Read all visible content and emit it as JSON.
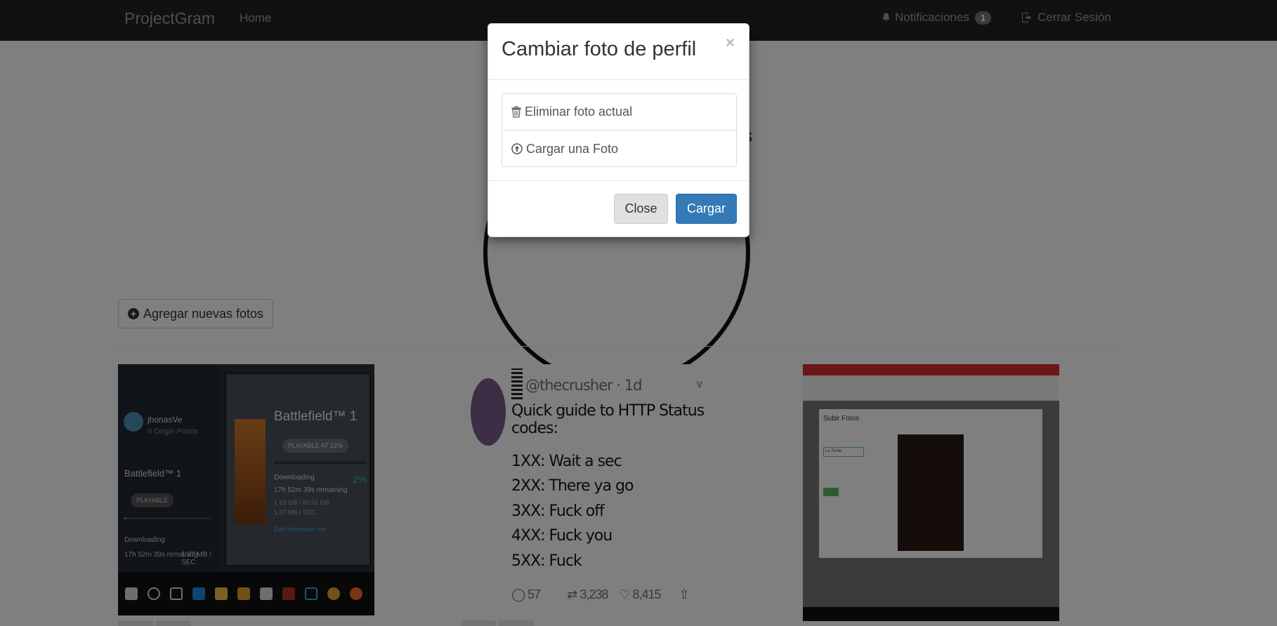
{
  "navbar": {
    "brand": "ProjectGram",
    "home": "Home",
    "notifications_label": "Notificaciones",
    "notifications_count": "1",
    "logout": "Cerrar Sesión"
  },
  "page": {
    "add_photos_label": "Agregar nuevas fotos",
    "profile_caption": "s"
  },
  "photos": {
    "game": {
      "username": "jhonasVe",
      "points": "0 Origin Points",
      "game_title": "Battlefield™ 1",
      "playable": "PLAYABLE",
      "downloading": "Downloading",
      "remaining": "17h 52m 39s remaining",
      "speed": "1.07 MB / SEC",
      "popup_title": "Battlefield™ 1",
      "popup_playable": "PLAYABLE AT 22%",
      "popup_percent": "2%",
      "popup_size": "1.93 GB / 60.51 GB",
      "popup_rate": "1.07 MB / SEC",
      "popup_limit": "Edit download rate",
      "progress": 0.02
    },
    "tweet": {
      "handle": "@thecrusher · 1d",
      "lines": [
        "Quick guide to HTTP Status codes:",
        "1XX: Wait a sec",
        "2XX: There ya go",
        "3XX: Fuck off",
        "4XX: Fuck you",
        "5XX: Fuck"
      ],
      "replies": "57",
      "retweets": "3,238",
      "likes": "8,415"
    },
    "screenshot": {
      "modal_title": "Subir Fotos",
      "input_value": "La Tarde"
    }
  },
  "modal": {
    "title": "Cambiar foto de perfil",
    "close_symbol": "×",
    "options": [
      {
        "label": "Eliminar foto actual",
        "icon": "trash-icon"
      },
      {
        "label": "Cargar una Foto",
        "icon": "upload-circle-icon"
      }
    ],
    "close_button": "Close",
    "upload_button": "Cargar"
  },
  "colors": {
    "navbar_bg": "#222222",
    "primary": "#337ab7",
    "backdrop": "rgba(0,0,0,0.5)"
  }
}
